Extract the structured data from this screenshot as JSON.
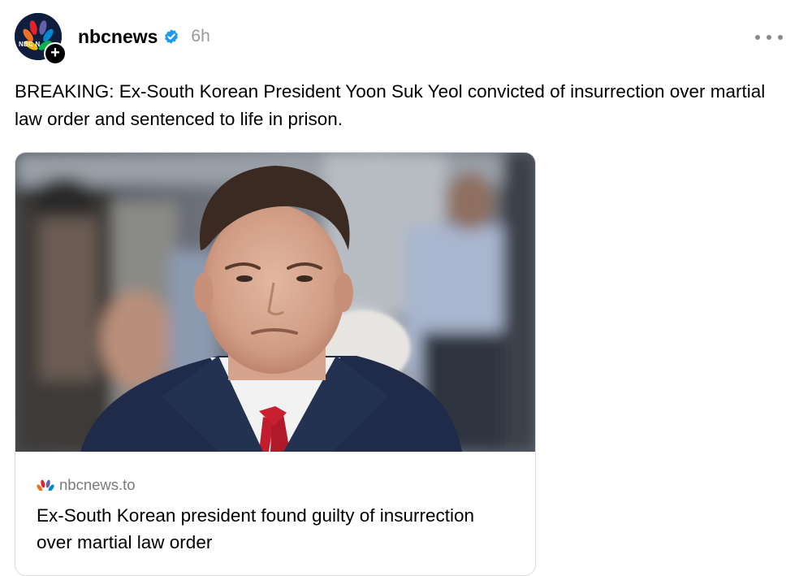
{
  "post": {
    "author": {
      "name": "nbcnews",
      "avatar_abbrev": "NBC N",
      "verified": true,
      "verified_icon": "verified-badge-icon",
      "timestamp": "6h"
    },
    "menu_icon": "more-options-icon",
    "text": "BREAKING: Ex-South Korean President Yoon Suk Yeol convicted of insurrection over martial law order and sentenced to life in prison.",
    "link_card": {
      "image_icon": "news-photo",
      "favicon": "nbc-peacock-icon",
      "domain": "nbcnews.to",
      "title": "Ex-South Korean president found guilty of insurrection over martial law order"
    }
  },
  "colors": {
    "verified_blue": "#1d9bf0",
    "timestamp_gray": "#999999",
    "domain_gray": "#7a7a7a",
    "card_border": "#d9d9d9",
    "peacock_red": "#e8202a",
    "peacock_orange": "#f37021",
    "peacock_yellow": "#fcb711",
    "peacock_green": "#0db14b",
    "peacock_blue": "#0089d0",
    "peacock_purple": "#6460aa"
  }
}
